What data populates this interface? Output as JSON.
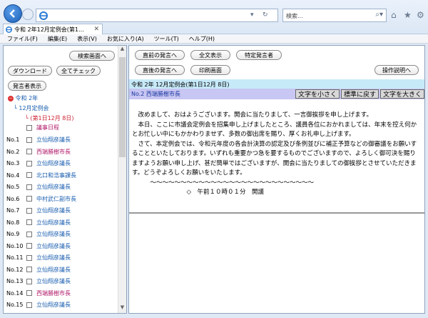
{
  "browser": {
    "search_placeholder": "検索...",
    "tab_title": "令和 2年12月定例会(第1...",
    "menu": [
      "ファイル(F)",
      "編集(E)",
      "表示(V)",
      "お気に入り(A)",
      "ツール(T)",
      "ヘルプ(H)"
    ]
  },
  "left": {
    "buttons": {
      "search_screen": "検索画面へ",
      "download": "ダウンロード",
      "check_all": "全てチェック",
      "show_speaker": "発言者表示"
    },
    "tree": {
      "year": "令和 2年",
      "session": "12月定例会",
      "day": "(第1日12月 8日)"
    },
    "agenda": "議事日程",
    "rows": [
      {
        "no": "No.1",
        "name": "立仙翔彦議長",
        "red": false
      },
      {
        "no": "No.2",
        "name": "西端勝樹市長",
        "red": true
      },
      {
        "no": "No.3",
        "name": "立仙翔彦議長",
        "red": false
      },
      {
        "no": "No.4",
        "name": "北口和浩事課長",
        "red": false
      },
      {
        "no": "No.5",
        "name": "立仙翔彦議長",
        "red": false
      },
      {
        "no": "No.6",
        "name": "中村武仁副市長",
        "red": false
      },
      {
        "no": "No.7",
        "name": "立仙翔彦議長",
        "red": false
      },
      {
        "no": "No.8",
        "name": "立仙翔彦議長",
        "red": false
      },
      {
        "no": "No.9",
        "name": "立仙翔彦議長",
        "red": false
      },
      {
        "no": "No.10",
        "name": "立仙翔彦議長",
        "red": false
      },
      {
        "no": "No.11",
        "name": "立仙翔彦議長",
        "red": false
      },
      {
        "no": "No.12",
        "name": "立仙翔彦議長",
        "red": false
      },
      {
        "no": "No.13",
        "name": "立仙翔彦議長",
        "red": false
      },
      {
        "no": "No.14",
        "name": "西端勝樹市長",
        "red": true
      },
      {
        "no": "No.15",
        "name": "立仙翔彦議長",
        "red": false
      }
    ]
  },
  "right": {
    "buttons": {
      "prev_speech": "直前の発言へ",
      "full_text": "全文表示",
      "specific_speaker": "特定発言者",
      "next_speech": "直後の発言へ",
      "print": "印刷画面",
      "help": "操作説明へ"
    },
    "meeting_title": "令和 2年 12月定例会(第1日12月 8日)",
    "speaker": "No.2 西端勝樹市長",
    "font_buttons": {
      "smaller": "文字を小さく",
      "reset": "標準に戻す",
      "larger": "文字を大きく"
    },
    "paragraphs": [
      "　改めまして、おはようございます。開会に当たりまして、一言御挨拶を申し上げます。",
      "　本日、ここに市議会定例会を招集申し上げましたところ、議員各位におかれましては、年末を控え何かとお忙しい中にもかかわりませず、多数の御出席を賜り、厚くお礼申し上げます。",
      "　さて、本定例会では、令和元年度の各会計決算の認定及び条例並びに補正予算などの御審議をお願いすることといたしております。いずれも重要かつ急を要するものでございますので、よろしく御可決を賜りますようお願い申し上げ、甚だ簡単ではございますが、開会に当たりましての御挨拶とさせていただきます。どうぞよろしくお願いをいたします。"
    ],
    "wave_line": "　　　～～～～～～～～～～～～～～～～～～～～～～～～～～～",
    "time_line": "　　　　　　　　　◇　午前１０時０１分　開議"
  }
}
